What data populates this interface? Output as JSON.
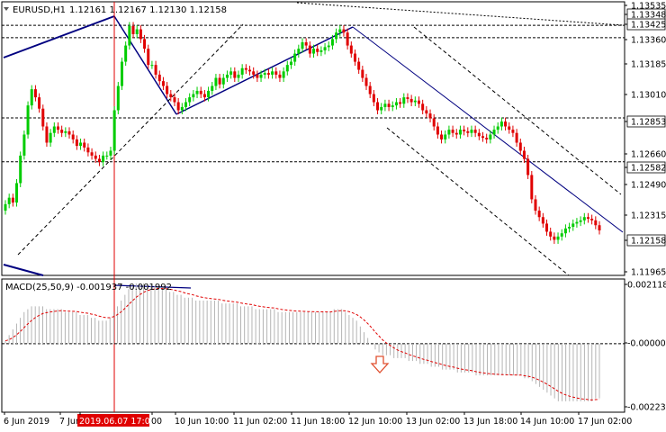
{
  "header": {
    "symbol": "EURUSD,H1",
    "ohlc": "1.12161 1.12167 1.12130 1.12158"
  },
  "macd": {
    "label": "MACD(25,50,9) -0.001937 -0.001992"
  },
  "colors": {
    "bull": "#00cc00",
    "bear": "#e00000",
    "trendline": "#000080",
    "grid": "#000000",
    "signal": "#e00000",
    "histogram": "#b4b4b4",
    "price_label_bg": "#ffffff",
    "arrow": "#e05030"
  },
  "chart_data": [
    {
      "type": "candlestick",
      "title": "EURUSD,H1",
      "ylim": [
        1.1188,
        1.1357
      ],
      "price_axis_labels": [
        "1.13535",
        "1.13348",
        "1.13425",
        "1.13360",
        "1.13185",
        "1.13010",
        "1.12853",
        "1.12660",
        "1.12582",
        "1.12490",
        "1.12315",
        "1.12158",
        "1.11965"
      ],
      "time_axis_labels": [
        "6 Jun 2019",
        "7 Jun",
        "2019.06.07 17:00",
        "00",
        "10 Jun 10:00",
        "11 Jun 02:00",
        "11 Jun 18:00",
        "12 Jun 10:00",
        "13 Jun 02:00",
        "13 Jun 18:00",
        "14 Jun 10:00",
        "17 Jun 02:00"
      ],
      "horizontal_levels": [
        1.13348,
        1.13425,
        1.12853,
        1.12582
      ],
      "close_prices": [
        1.1232,
        1.1236,
        1.1233,
        1.1245,
        1.1262,
        1.1275,
        1.1293,
        1.1303,
        1.1298,
        1.1291,
        1.128,
        1.127,
        1.1276,
        1.128,
        1.1278,
        1.1276,
        1.1277,
        1.1275,
        1.1272,
        1.1268,
        1.127,
        1.1267,
        1.1264,
        1.1262,
        1.126,
        1.1258,
        1.1262,
        1.1262,
        1.1265,
        1.129,
        1.1305,
        1.132,
        1.133,
        1.1342,
        1.1337,
        1.134,
        1.1334,
        1.1328,
        1.1318,
        1.1318,
        1.1312,
        1.1308,
        1.1305,
        1.13,
        1.1298,
        1.1295,
        1.129,
        1.1292,
        1.1295,
        1.1298,
        1.13,
        1.1302,
        1.13,
        1.1298,
        1.1302,
        1.1305,
        1.131,
        1.1306,
        1.131,
        1.1312,
        1.1314,
        1.131,
        1.1312,
        1.1316,
        1.1315,
        1.1314,
        1.1312,
        1.131,
        1.1312,
        1.1313,
        1.1312,
        1.1314,
        1.1312,
        1.131,
        1.1314,
        1.1318,
        1.132,
        1.1325,
        1.1328,
        1.1332,
        1.133,
        1.1325,
        1.1328,
        1.1326,
        1.1327,
        1.1329,
        1.133,
        1.1334,
        1.1338,
        1.134,
        1.1338,
        1.133,
        1.1325,
        1.132,
        1.1315,
        1.131,
        1.1305,
        1.13,
        1.1295,
        1.129,
        1.1292,
        1.1294,
        1.1292,
        1.1293,
        1.1295,
        1.1294,
        1.1298,
        1.1297,
        1.1295,
        1.1296,
        1.1294,
        1.129,
        1.1288,
        1.1285,
        1.128,
        1.1275,
        1.1272,
        1.1275,
        1.1278,
        1.1276,
        1.1275,
        1.1278,
        1.1277,
        1.1276,
        1.1278,
        1.1276,
        1.1274,
        1.1273,
        1.1272,
        1.1275,
        1.1278,
        1.128,
        1.1283,
        1.128,
        1.1278,
        1.1276,
        1.127,
        1.1265,
        1.126,
        1.125,
        1.1235,
        1.1228,
        1.1224,
        1.122,
        1.1215,
        1.1212,
        1.121,
        1.1212,
        1.1214,
        1.1217,
        1.1218,
        1.122,
        1.1221,
        1.1222,
        1.1224,
        1.1223,
        1.1222,
        1.1219,
        1.12158
      ],
      "macd_panel": {
        "histogram": [
          0.0001,
          0.0003,
          0.0005,
          0.0007,
          0.0009,
          0.0011,
          0.0012,
          0.0013,
          0.0013,
          0.0013,
          0.0013,
          0.0012,
          0.0012,
          0.0012,
          0.0012,
          0.0012,
          0.0011,
          0.0011,
          0.0011,
          0.0011,
          0.001,
          0.001,
          0.001,
          0.0009,
          0.0009,
          0.0008,
          0.0008,
          0.0008,
          0.0009,
          0.0011,
          0.0013,
          0.0015,
          0.0017,
          0.0019,
          0.002,
          0.0021,
          0.0021,
          0.0021,
          0.0021,
          0.002,
          0.002,
          0.002,
          0.0019,
          0.0019,
          0.0018,
          0.0018,
          0.0017,
          0.0017,
          0.0016,
          0.0016,
          0.0016,
          0.0015,
          0.0015,
          0.0015,
          0.0015,
          0.0015,
          0.0015,
          0.0015,
          0.0014,
          0.0014,
          0.0014,
          0.0014,
          0.0014,
          0.0013,
          0.0013,
          0.0013,
          0.0013,
          0.0012,
          0.0012,
          0.0012,
          0.0012,
          0.0012,
          0.0012,
          0.0011,
          0.0011,
          0.0011,
          0.0011,
          0.0011,
          0.0011,
          0.0011,
          0.0011,
          0.0011,
          0.0011,
          0.0011,
          0.0011,
          0.0011,
          0.0011,
          0.0011,
          0.0012,
          0.0012,
          0.0012,
          0.0011,
          0.001,
          0.0009,
          0.0008,
          0.0006,
          0.0004,
          0.0002,
          0.0,
          -0.0002,
          -0.0003,
          -0.0004,
          -0.0004,
          -0.0004,
          -0.0005,
          -0.0005,
          -0.0005,
          -0.0005,
          -0.0006,
          -0.0006,
          -0.0006,
          -0.0007,
          -0.0007,
          -0.0007,
          -0.0008,
          -0.0008,
          -0.0008,
          -0.0009,
          -0.0009,
          -0.0009,
          -0.0009,
          -0.001,
          -0.001,
          -0.001,
          -0.001,
          -0.001,
          -0.0011,
          -0.0011,
          -0.0011,
          -0.0011,
          -0.0011,
          -0.0011,
          -0.0011,
          -0.0011,
          -0.0011,
          -0.0011,
          -0.0011,
          -0.0011,
          -0.0011,
          -0.0012,
          -0.0012,
          -0.0013,
          -0.0014,
          -0.0015,
          -0.0016,
          -0.0017,
          -0.0018,
          -0.0019,
          -0.002,
          -0.002,
          -0.002,
          -0.002,
          -0.002,
          -0.002,
          -0.002,
          -0.002,
          -0.002,
          -0.002,
          -0.0019,
          -0.0019
        ],
        "y_axis_labels": [
          "0.002118",
          "-0.000004",
          "-0.002235"
        ],
        "ylim": [
          -0.00238,
          0.00225
        ]
      }
    }
  ]
}
